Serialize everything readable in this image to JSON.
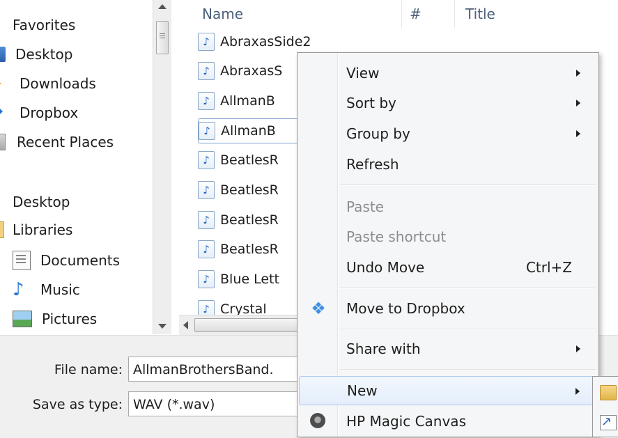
{
  "nav": {
    "favorites_header": "Favorites",
    "favorites": [
      {
        "label": "Desktop",
        "icon": "desktop-icon"
      },
      {
        "label": "Downloads",
        "icon": "downloads-icon"
      },
      {
        "label": "Dropbox",
        "icon": "dropbox-icon"
      },
      {
        "label": "Recent Places",
        "icon": "recent-places-icon"
      }
    ],
    "desktop_header": "Desktop",
    "desktop_items": [
      {
        "label": "Libraries",
        "icon": "libraries-icon"
      },
      {
        "label": "Documents",
        "icon": "documents-icon"
      },
      {
        "label": "Music",
        "icon": "music-icon"
      },
      {
        "label": "Pictures",
        "icon": "pictures-icon"
      }
    ]
  },
  "filelist": {
    "columns": {
      "name": "Name",
      "number": "#",
      "title": "Title"
    },
    "files": [
      "AbraxasSide2",
      "AbraxasS",
      "AllmanB",
      "AllmanB",
      "BeatlesR",
      "BeatlesR",
      "BeatlesR",
      "BeatlesR",
      "Blue Lett",
      "Crystal"
    ],
    "selected_index": 3
  },
  "form": {
    "file_name_label": "File name:",
    "file_name_value": "AllmanBrothersBand.",
    "save_as_type_label": "Save as type:",
    "save_as_type_value": "WAV (*.wav)"
  },
  "context_menu": {
    "items": [
      {
        "label": "View",
        "submenu": true
      },
      {
        "label": "Sort by",
        "submenu": true
      },
      {
        "label": "Group by",
        "submenu": true
      },
      {
        "label": "Refresh"
      },
      {
        "label": "Paste",
        "disabled": true
      },
      {
        "label": "Paste shortcut",
        "disabled": true
      },
      {
        "label": "Undo Move",
        "shortcut": "Ctrl+Z"
      },
      {
        "label": "Move to Dropbox",
        "icon": "dropbox-icon"
      },
      {
        "label": "Share with",
        "submenu": true
      },
      {
        "label": "New",
        "submenu": true,
        "highlighted": true
      },
      {
        "label": "HP Magic Canvas",
        "icon": "hp-magic-canvas-icon"
      }
    ]
  },
  "colors": {
    "menu_background": "#f5f6f7",
    "menu_highlight": "#e4eefb",
    "selection_border": "#7da2ce",
    "column_header_text": "#4c607a",
    "disabled_text": "#8d8d8d"
  }
}
